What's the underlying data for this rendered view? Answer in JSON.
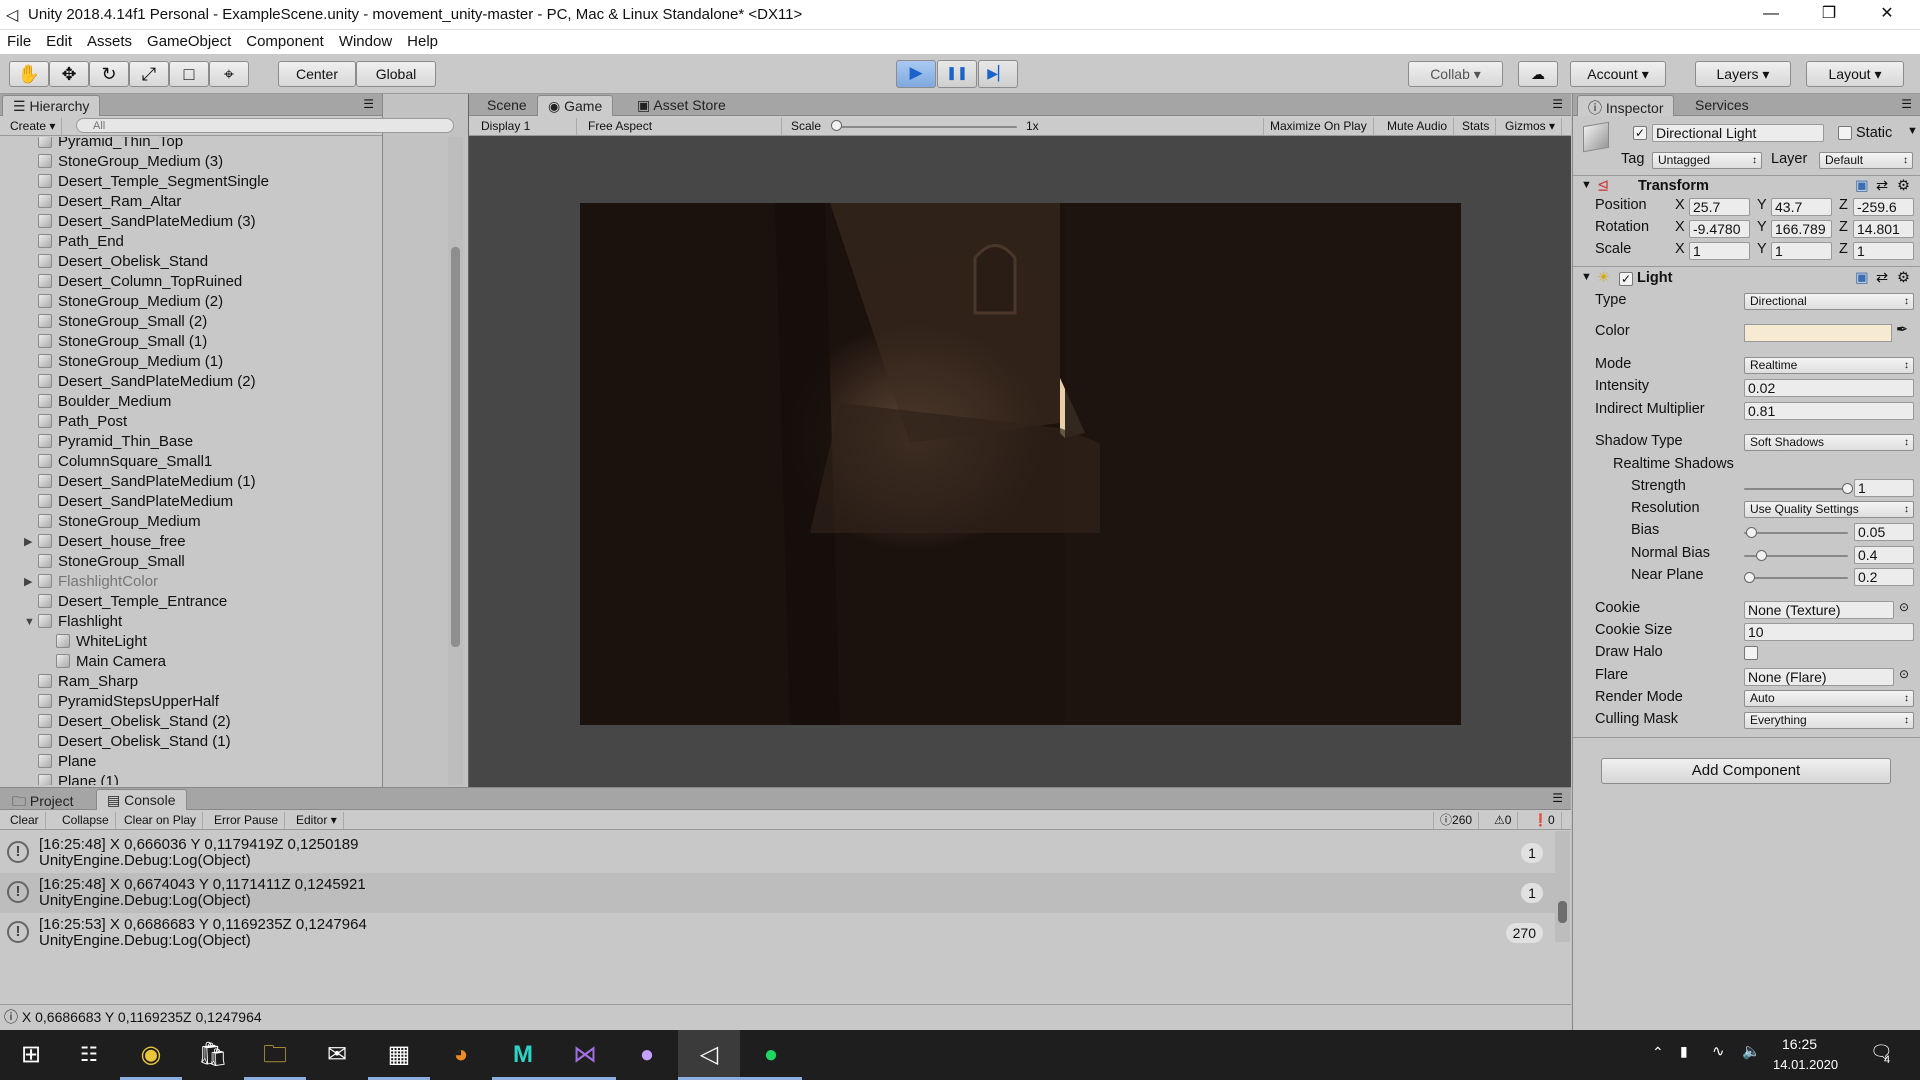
{
  "window": {
    "title": "Unity 2018.4.14f1 Personal - ExampleScene.unity - movement_unity-master - PC, Mac & Linux Standalone* <DX11>",
    "minimize": "—",
    "restore": "❒",
    "close": "✕"
  },
  "menu": [
    "File",
    "Edit",
    "Assets",
    "GameObject",
    "Component",
    "Window",
    "Help"
  ],
  "toolbar": {
    "tools": [
      "hand-icon",
      "move-icon",
      "rotate-icon",
      "scale-icon",
      "rect-icon",
      "transform-icon"
    ],
    "tool_glyphs": [
      "✋",
      "✥",
      "↻",
      "⤢",
      "□",
      "⌖"
    ],
    "center": "Center",
    "global": "Global",
    "play": "▶",
    "pause": "❚❚",
    "step": "▶▏",
    "collab": "Collab",
    "cloud": "☁",
    "account": "Account",
    "layers": "Layers",
    "layout": "Layout"
  },
  "hierarchy": {
    "tab": "Hierarchy",
    "create": "Create",
    "search_placeholder": "All",
    "items": [
      {
        "label": "Pyramid_Thin_Top",
        "indent": 0,
        "fold": "",
        "dim": false
      },
      {
        "label": "StoneGroup_Medium (3)",
        "indent": 0,
        "fold": "",
        "dim": false
      },
      {
        "label": "Desert_Temple_SegmentSingle",
        "indent": 0,
        "fold": "",
        "dim": false
      },
      {
        "label": "Desert_Ram_Altar",
        "indent": 0,
        "fold": "",
        "dim": false
      },
      {
        "label": "Desert_SandPlateMedium (3)",
        "indent": 0,
        "fold": "",
        "dim": false
      },
      {
        "label": "Path_End",
        "indent": 0,
        "fold": "",
        "dim": false
      },
      {
        "label": "Desert_Obelisk_Stand",
        "indent": 0,
        "fold": "",
        "dim": false
      },
      {
        "label": "Desert_Column_TopRuined",
        "indent": 0,
        "fold": "",
        "dim": false
      },
      {
        "label": "StoneGroup_Medium (2)",
        "indent": 0,
        "fold": "",
        "dim": false
      },
      {
        "label": "StoneGroup_Small (2)",
        "indent": 0,
        "fold": "",
        "dim": false
      },
      {
        "label": "StoneGroup_Small (1)",
        "indent": 0,
        "fold": "",
        "dim": false
      },
      {
        "label": "StoneGroup_Medium (1)",
        "indent": 0,
        "fold": "",
        "dim": false
      },
      {
        "label": "Desert_SandPlateMedium (2)",
        "indent": 0,
        "fold": "",
        "dim": false
      },
      {
        "label": "Boulder_Medium",
        "indent": 0,
        "fold": "",
        "dim": false
      },
      {
        "label": "Path_Post",
        "indent": 0,
        "fold": "",
        "dim": false
      },
      {
        "label": "Pyramid_Thin_Base",
        "indent": 0,
        "fold": "",
        "dim": false
      },
      {
        "label": "ColumnSquare_Small1",
        "indent": 0,
        "fold": "",
        "dim": false
      },
      {
        "label": "Desert_SandPlateMedium (1)",
        "indent": 0,
        "fold": "",
        "dim": false
      },
      {
        "label": "Desert_SandPlateMedium",
        "indent": 0,
        "fold": "",
        "dim": false
      },
      {
        "label": "StoneGroup_Medium",
        "indent": 0,
        "fold": "",
        "dim": false
      },
      {
        "label": "Desert_house_free",
        "indent": 0,
        "fold": "▶",
        "dim": false
      },
      {
        "label": "StoneGroup_Small",
        "indent": 0,
        "fold": "",
        "dim": false
      },
      {
        "label": "FlashlightColor",
        "indent": 0,
        "fold": "▶",
        "dim": true
      },
      {
        "label": "Desert_Temple_Entrance",
        "indent": 0,
        "fold": "",
        "dim": false
      },
      {
        "label": "Flashlight",
        "indent": 0,
        "fold": "▼",
        "dim": false
      },
      {
        "label": "WhiteLight",
        "indent": 1,
        "fold": "",
        "dim": false
      },
      {
        "label": "Main Camera",
        "indent": 1,
        "fold": "",
        "dim": false
      },
      {
        "label": "Ram_Sharp",
        "indent": 0,
        "fold": "",
        "dim": false
      },
      {
        "label": "PyramidStepsUpperHalf",
        "indent": 0,
        "fold": "",
        "dim": false
      },
      {
        "label": "Desert_Obelisk_Stand (2)",
        "indent": 0,
        "fold": "",
        "dim": false
      },
      {
        "label": "Desert_Obelisk_Stand (1)",
        "indent": 0,
        "fold": "",
        "dim": false
      },
      {
        "label": "Plane",
        "indent": 0,
        "fold": "",
        "dim": false
      },
      {
        "label": "Plane (1)",
        "indent": 0,
        "fold": "",
        "dim": false
      }
    ]
  },
  "game": {
    "tabs": [
      "Scene",
      "Game",
      "Asset Store"
    ],
    "display": "Display 1",
    "aspect": "Free Aspect",
    "scale_label": "Scale",
    "scale_value": "1x",
    "maximize": "Maximize On Play",
    "mute": "Mute Audio",
    "stats": "Stats",
    "gizmos": "Gizmos"
  },
  "inspector": {
    "tabs": [
      "Inspector",
      "Services"
    ],
    "object_name": "Directional Light",
    "static": "Static",
    "tag_label": "Tag",
    "tag": "Untagged",
    "layer_label": "Layer",
    "layer": "Default",
    "transform": {
      "title": "Transform",
      "position_label": "Position",
      "rotation_label": "Rotation",
      "scale_label": "Scale",
      "position": [
        "25.7",
        "43.7",
        "-259.6"
      ],
      "rotation": [
        "-9.4780",
        "166.789",
        "14.801"
      ],
      "scale": [
        "1",
        "1",
        "1"
      ],
      "axes": [
        "X",
        "Y",
        "Z"
      ]
    },
    "light": {
      "title": "Light",
      "type_label": "Type",
      "type": "Directional",
      "color_label": "Color",
      "color": "#f7ead2",
      "mode_label": "Mode",
      "mode": "Realtime",
      "intensity_label": "Intensity",
      "intensity": "0.02",
      "indirect_label": "Indirect Multiplier",
      "indirect": "0.81",
      "shadow_type_label": "Shadow Type",
      "shadow_type": "Soft Shadows",
      "realtime_label": "Realtime Shadows",
      "strength_label": "Strength",
      "strength": "1",
      "resolution_label": "Resolution",
      "resolution": "Use Quality Settings",
      "bias_label": "Bias",
      "bias": "0.05",
      "normal_bias_label": "Normal Bias",
      "normal_bias": "0.4",
      "near_plane_label": "Near Plane",
      "near_plane": "0.2",
      "cookie_label": "Cookie",
      "cookie": "None (Texture)",
      "cookie_size_label": "Cookie Size",
      "cookie_size": "10",
      "draw_halo_label": "Draw Halo",
      "flare_label": "Flare",
      "flare": "None (Flare)",
      "render_mode_label": "Render Mode",
      "render_mode": "Auto",
      "culling_label": "Culling Mask",
      "culling": "Everything"
    },
    "add_component": "Add Component"
  },
  "console": {
    "tabs": [
      "Project",
      "Console"
    ],
    "buttons": [
      "Clear",
      "Collapse",
      "Clear on Play",
      "Error Pause",
      "Editor"
    ],
    "counts": {
      "logs": "260",
      "warnings": "0",
      "errors": "0"
    },
    "entries": [
      {
        "line1": "[16:25:48] X 0,666036 Y 0,1179419Z 0,1250189",
        "line2": "UnityEngine.Debug:Log(Object)",
        "count": "1"
      },
      {
        "line1": "[16:25:48] X 0,6674043 Y 0,1171411Z 0,1245921",
        "line2": "UnityEngine.Debug:Log(Object)",
        "count": "1"
      },
      {
        "line1": "[16:25:53] X 0,6686683 Y 0,1169235Z 0,1247964",
        "line2": "UnityEngine.Debug:Log(Object)",
        "count": "270"
      }
    ]
  },
  "status": "X 0,6686683 Y 0,1169235Z 0,1247964",
  "taskbar": {
    "icons": [
      "windows-start-icon",
      "task-view-icon",
      "chrome-icon",
      "store-icon",
      "file-explorer-icon",
      "mail-icon",
      "app-icon",
      "blender-icon",
      "maya-icon",
      "visual-studio-icon",
      "github-icon",
      "unity-icon",
      "spotify-icon"
    ],
    "time": "16:25",
    "date": "14.01.2020",
    "notifications": "4"
  }
}
